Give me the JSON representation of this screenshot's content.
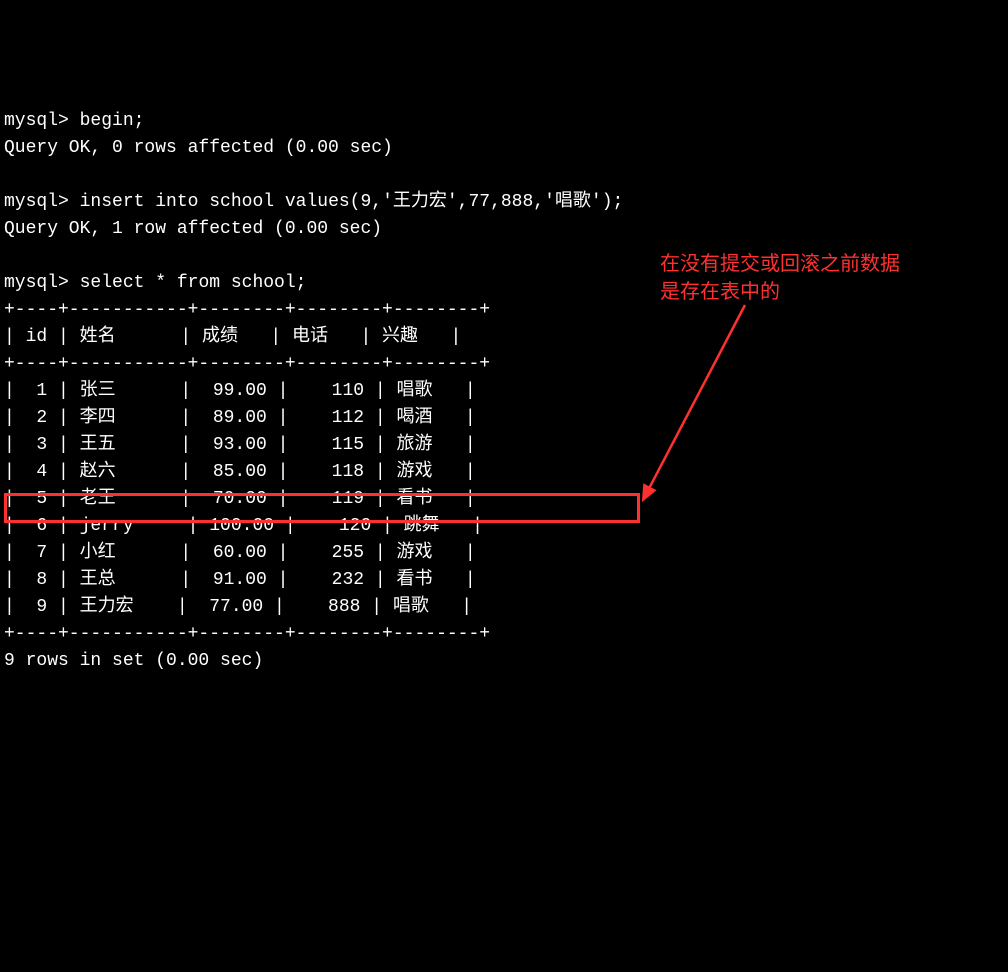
{
  "prompt": "mysql>",
  "commands": {
    "begin": "begin;",
    "begin_result": "Query OK, 0 rows affected (0.00 sec)",
    "insert": "insert into school values(9,'王力宏',77,888,'唱歌');",
    "insert_result": "Query OK, 1 row affected (0.00 sec)",
    "select": "select * from school;"
  },
  "table": {
    "border_top": "+----+-----------+--------+--------+--------+",
    "header_row": "| id | 姓名      | 成绩   | 电话   | 兴趣   |",
    "border_mid": "+----+-----------+--------+--------+--------+",
    "rows": [
      "|  1 | 张三      |  99.00 |    110 | 唱歌   |",
      "|  2 | 李四      |  89.00 |    112 | 喝酒   |",
      "|  3 | 王五      |  93.00 |    115 | 旅游   |",
      "|  4 | 赵六      |  85.00 |    118 | 游戏   |",
      "|  5 | 老王      |  70.00 |    119 | 看书   |",
      "|  6 | jerry     | 100.00 |    120 | 跳舞   |",
      "|  7 | 小红      |  60.00 |    255 | 游戏   |",
      "|  8 | 王总      |  91.00 |    232 | 看书   |",
      "|  9 | 王力宏    |  77.00 |    888 | 唱歌   |"
    ],
    "border_bot": "+----+-----------+--------+--------+--------+",
    "footer": "9 rows in set (0.00 sec)"
  },
  "annotation": {
    "line1": "在没有提交或回滚之前数据",
    "line2": "是存在表中的"
  },
  "chart_data": {
    "type": "table",
    "title": "school",
    "columns": [
      "id",
      "姓名",
      "成绩",
      "电话",
      "兴趣"
    ],
    "rows": [
      {
        "id": 1,
        "姓名": "张三",
        "成绩": 99.0,
        "电话": 110,
        "兴趣": "唱歌"
      },
      {
        "id": 2,
        "姓名": "李四",
        "成绩": 89.0,
        "电话": 112,
        "兴趣": "喝酒"
      },
      {
        "id": 3,
        "姓名": "王五",
        "成绩": 93.0,
        "电话": 115,
        "兴趣": "旅游"
      },
      {
        "id": 4,
        "姓名": "赵六",
        "成绩": 85.0,
        "电话": 118,
        "兴趣": "游戏"
      },
      {
        "id": 5,
        "姓名": "老王",
        "成绩": 70.0,
        "电话": 119,
        "兴趣": "看书"
      },
      {
        "id": 6,
        "姓名": "jerry",
        "成绩": 100.0,
        "电话": 120,
        "兴趣": "跳舞"
      },
      {
        "id": 7,
        "姓名": "小红",
        "成绩": 60.0,
        "电话": 255,
        "兴趣": "游戏"
      },
      {
        "id": 8,
        "姓名": "王总",
        "成绩": 91.0,
        "电话": 232,
        "兴趣": "看书"
      },
      {
        "id": 9,
        "姓名": "王力宏",
        "成绩": 77.0,
        "电话": 888,
        "兴趣": "唱歌"
      }
    ]
  }
}
